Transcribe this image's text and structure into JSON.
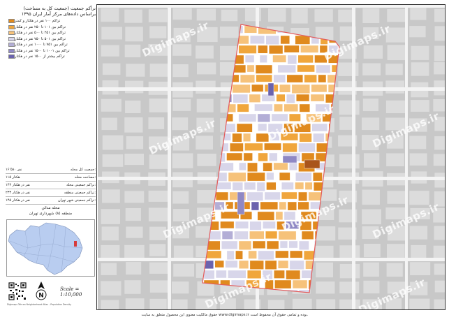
{
  "title": {
    "line1": "نرآکم جمعیت (جمعیت کل به مساحت)",
    "line2": "براساس داده‌های مرکز آمار ایران ۱۳۹۵"
  },
  "legend": [
    {
      "label": "تراکم ۱۰۰ نفر در هکتار و کمتر",
      "color": "#e08a1e"
    },
    {
      "label": "تراکم بین ۱۰۱ تا ۲۵۰ نفر در هکتار",
      "color": "#f0a63c"
    },
    {
      "label": "تراکم بین ۲۵۱ تا ۵۰۰ نفر در هکتار",
      "color": "#f6c27a"
    },
    {
      "label": "تراکم بین ۵۰۱ تا ۷۵۰ نفر در هکتار",
      "color": "#d8d6ea"
    },
    {
      "label": "تراکم بین ۷۵۱ تا ۱۰۰۰ نفر در هکتار",
      "color": "#b3aed6"
    },
    {
      "label": "تراکم بین ۱۰۰۱ تا ۱۵۰۰ نفر در هکتار",
      "color": "#8f88c4"
    },
    {
      "label": "تراکم بیشتر از ۱۵۰۰ نفر در هکتار",
      "color": "#6a62ae"
    }
  ],
  "stats": [
    {
      "label": "جمعیت کل محله:",
      "value": "۱۶٬۵۸۰ نفر"
    },
    {
      "label": "مساحت محله:",
      "value": "۱۱۵ هکتار"
    },
    {
      "label": "تراکم جمعیتی محله:",
      "value": "۱۴۳ نفر در هکتار"
    },
    {
      "label": "تراکم جمعیتی منطقه:",
      "value": "۲۳۳ نفر در هکتار"
    },
    {
      "label": "تراکم جمعیتی شهر تهران:",
      "value": "۱۴۵ نفر در هکتار"
    }
  ],
  "location": {
    "line1": "محله مدائن",
    "line2": "منطقه (۸) شهرداری تهران"
  },
  "scale": "Scale = 1:10,000",
  "north_label": "N",
  "credit": "Digimaps Tehran Neighborhood Atlas - Population Density",
  "watermark": "Digimaps.ir",
  "footer": "حقوق مالکیت معنوی این محصول متعلق به سایت www.digimaps.ir بوده و تمامی حقوق آن محفوظ است.",
  "colors": {
    "frame": "#333333",
    "map_bg": "#c8c8c8",
    "block_fill": "#ffffff",
    "boundary": "#e35a5a",
    "inset_district": "#b9cdf0",
    "inset_highlight": "#d63a3a"
  },
  "icons": [
    "north-arrow-icon",
    "qr-code-icon",
    "instagram-icon",
    "telegram-icon"
  ]
}
